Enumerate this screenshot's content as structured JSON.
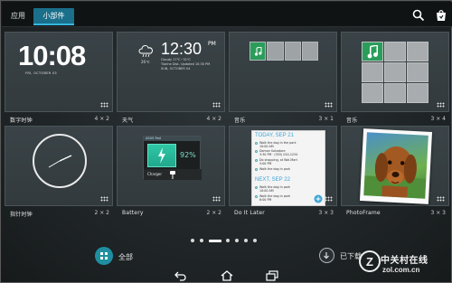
{
  "tabs": [
    {
      "label": "应用"
    },
    {
      "label": "小部件"
    }
  ],
  "colors": {
    "accent": "#1a6f8a",
    "accent_line": "#37b6e0",
    "music_green": "#2a9d5a"
  },
  "widgets": [
    {
      "label": "数字时钟",
      "size": "4 × 2",
      "time": "10:08",
      "date": "FRI, OCTOBER 03"
    },
    {
      "label": "天气",
      "size": "4 × 2",
      "time": "12:30",
      "ampm": "PM",
      "line1": "Cloudy 17℃~31℃",
      "line2": "Tianhe Dist. Updated 10:30 PM",
      "line3": "SUN, OCTOBER 04",
      "temp": "26℃"
    },
    {
      "label": "音乐",
      "size": "3 × 1"
    },
    {
      "label": "音乐",
      "size": "3 × 4"
    },
    {
      "label": "指针时钟",
      "size": "2 × 2"
    },
    {
      "label": "Battery",
      "size": "2 × 2",
      "header": "ASUS Pad",
      "percent": "92%",
      "charger": "Charger"
    },
    {
      "label": "Do It Later",
      "size": "3 × 3",
      "today": "TODAY, SEP 21",
      "items_today": [
        {
          "title": "Walk the dog in the park",
          "sub": "10:00 AM"
        },
        {
          "title": "Damon Salvatore",
          "sub": "3:30 PM · (555) 010-1234"
        },
        {
          "title": "Do shopping, at Wal-Mart",
          "sub": "5:00 PM"
        },
        {
          "title": "Walk the dog in park",
          "sub": ""
        }
      ],
      "next": "NEXT, SEP 22",
      "items_next": [
        {
          "title": "Walk the dog in park",
          "sub": "10:00 AM"
        },
        {
          "title": "Walk the dog in park",
          "sub": "6:00 PM"
        }
      ]
    },
    {
      "label": "PhotoFrame",
      "size": "3 × 3"
    }
  ],
  "page_indicator": {
    "count": 7,
    "active_index": 2
  },
  "bottom": {
    "all_label": "全部",
    "downloaded_label": "已下载"
  },
  "watermark": {
    "brand": "中关村在线",
    "url": "zol.com.cn"
  }
}
